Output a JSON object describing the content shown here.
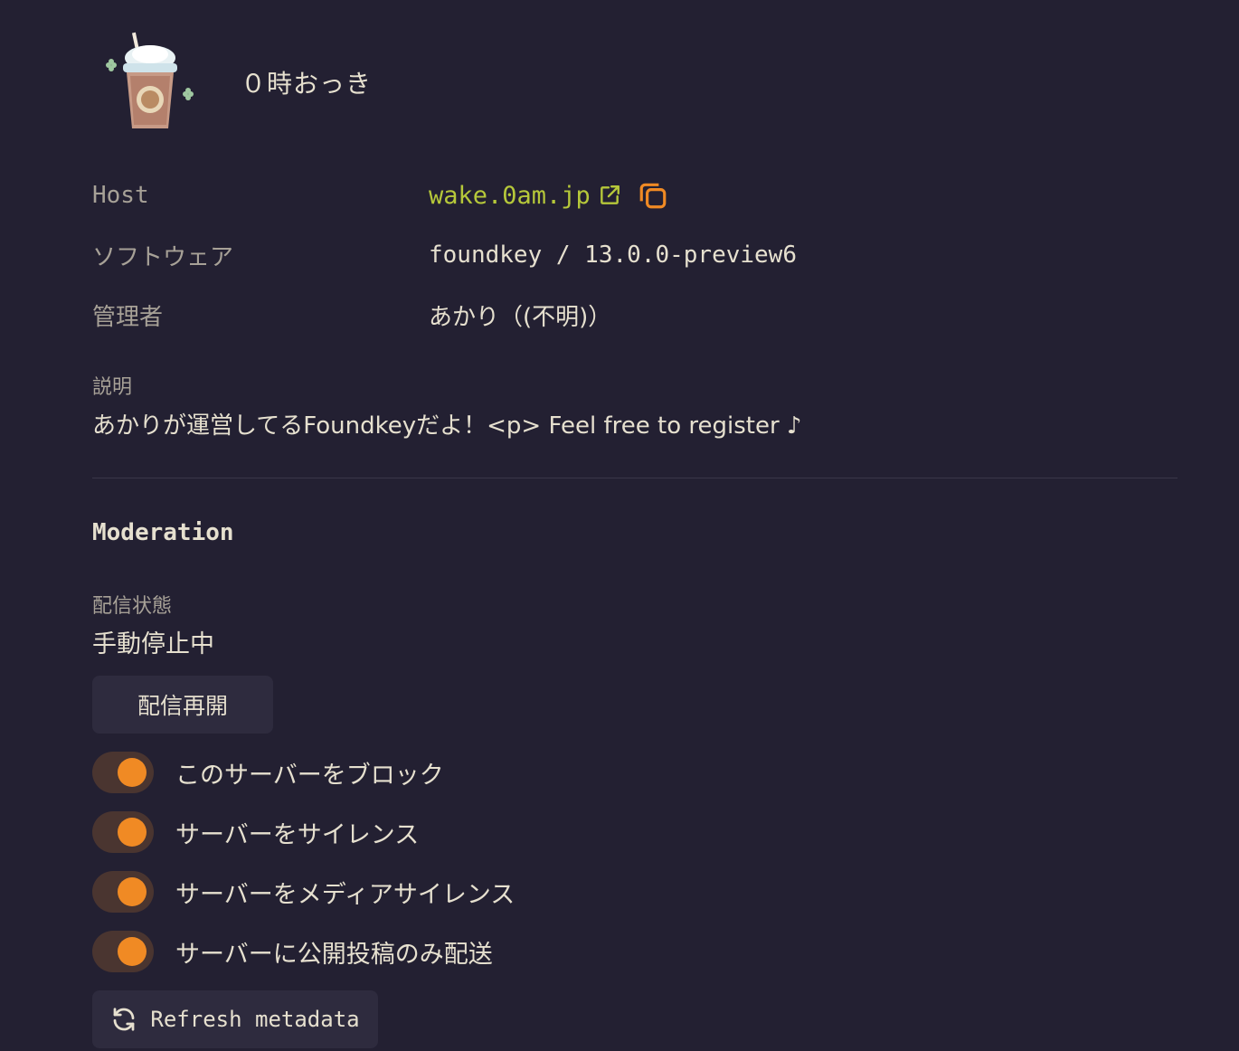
{
  "instance": {
    "name": "０時おっき"
  },
  "info": {
    "host_label": "Host",
    "host_value": "wake.0am.jp",
    "software_label": "ソフトウェア",
    "software_value": "foundkey / 13.0.0-preview6",
    "admin_label": "管理者",
    "admin_value": "あかり（(不明)）"
  },
  "description": {
    "label": "説明",
    "text": "あかりが運営してるFoundkeyだよ！<p> Feel free to register ♪"
  },
  "moderation": {
    "title": "Moderation",
    "delivery_status_label": "配信状態",
    "delivery_status_value": "手動停止中",
    "resume_button": "配信再開",
    "toggles": [
      {
        "label": "このサーバーをブロック",
        "on": true
      },
      {
        "label": "サーバーをサイレンス",
        "on": true
      },
      {
        "label": "サーバーをメディアサイレンス",
        "on": true
      },
      {
        "label": "サーバーに公開投稿のみ配送",
        "on": true
      }
    ],
    "refresh_button": "Refresh metadata"
  },
  "colors": {
    "background": "#232032",
    "accent": "#f08a24",
    "link": "#b6c83a",
    "muted_text": "#a7a197",
    "text": "#e6e0cf"
  },
  "icons": {
    "external_link": "external-link-icon",
    "copy": "copy-icon",
    "refresh": "refresh-icon"
  }
}
